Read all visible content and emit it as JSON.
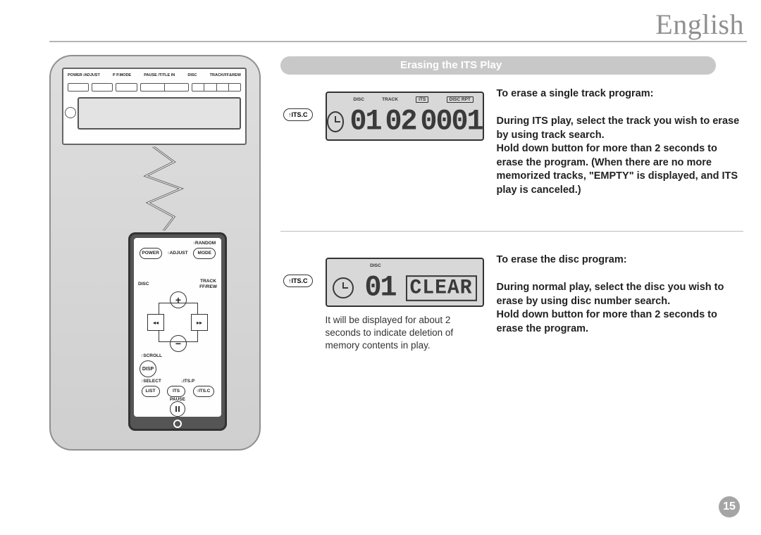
{
  "header": {
    "language": "English"
  },
  "section_title": "Erasing the ITS Play",
  "page_number": "15",
  "headunit_labels": {
    "l1": "POWER\n/ADJUST",
    "l2": "P P.MODE",
    "l3": "PAUSE\n/TITLE IN",
    "l4": "DISC",
    "l5": "TRACK/FF&REW"
  },
  "remote": {
    "random": "↑RANDOM",
    "power": "POWER",
    "adjust": "↑ADJUST",
    "mode": "MODE",
    "disc": "DISC",
    "track": "TRACK\nFF/REW",
    "scroll": "↑SCROLL",
    "disp": "DISP",
    "select": "↑SELECT",
    "itsp": "↓ITS.P",
    "list": "LIST",
    "its": "ITS",
    "itsc": "↑ITS.C",
    "pause": "PAUSE"
  },
  "block1": {
    "button": "↑ITS.C",
    "lcd_top": {
      "a": "DISC",
      "b": "TRACK",
      "c": "ITS",
      "d": "DISC RPT"
    },
    "lcd_digits": {
      "d1": "01",
      "d2": "02",
      "d3": "0001"
    },
    "heading": "To erase a single track program:",
    "line1": "During ITS play, select the track you wish to erase by using track search.",
    "line2": "Hold down button for more than 2 seconds to erase the program. (When there are no more memorized tracks, \"EMPTY\" is displayed, and ITS play is canceled.)"
  },
  "block2": {
    "button": "↑ITS.C",
    "lcd_top": {
      "a": "DISC"
    },
    "lcd_digits": {
      "d1": "01",
      "clear": "CLEAR"
    },
    "caption": "It will be displayed for about 2 seconds to indicate deletion of memory contents in play.",
    "heading": "To erase the disc program:",
    "line1": "During normal play, select the disc you wish to erase by using disc number search.",
    "line2": "Hold down button for more than 2 seconds to erase the program."
  }
}
